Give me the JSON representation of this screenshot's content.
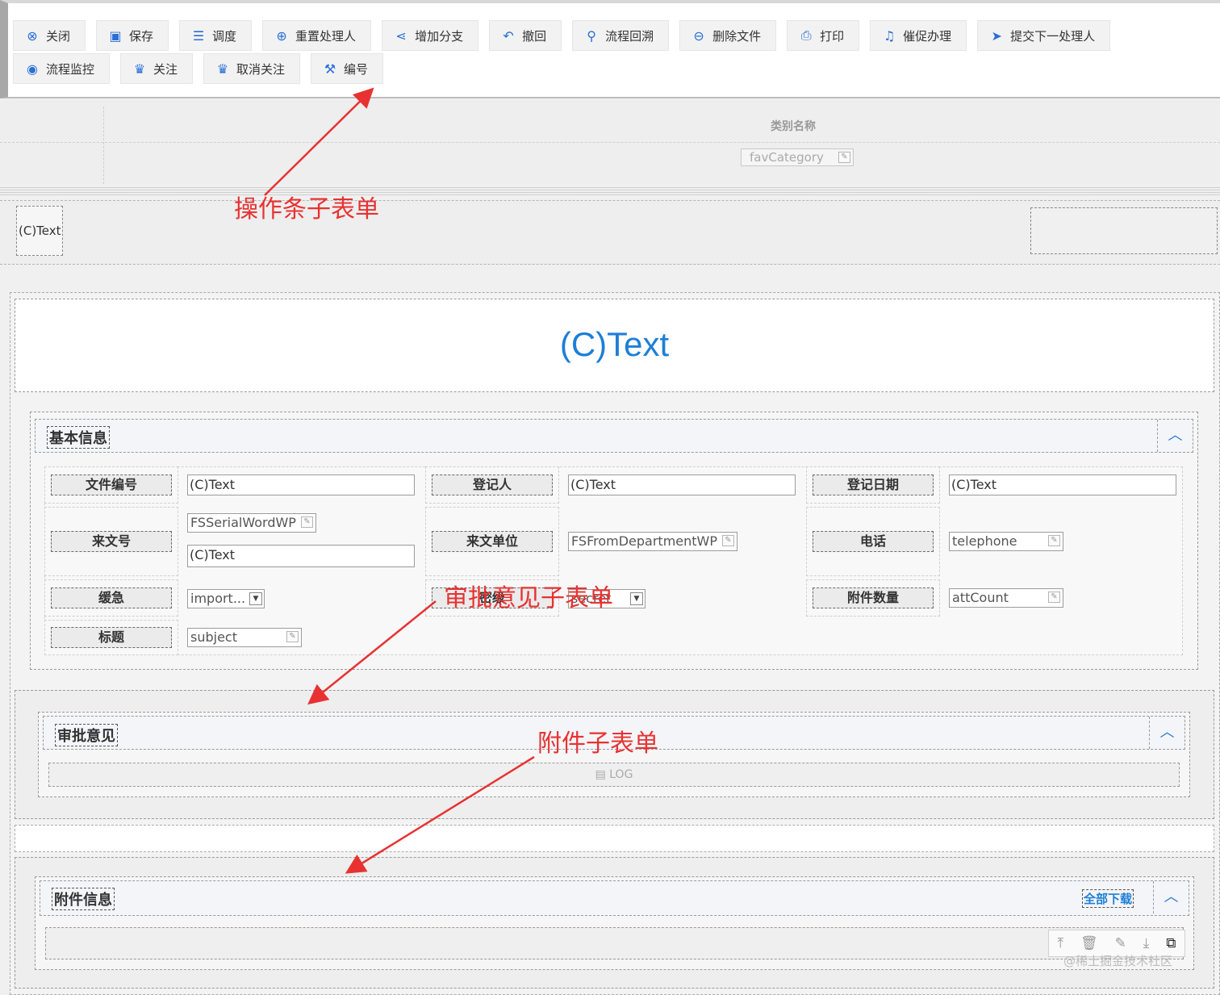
{
  "toolbar": {
    "row1": [
      {
        "label": "关闭",
        "icon": "close-circle-icon",
        "glyph": "⊗"
      },
      {
        "label": "保存",
        "icon": "save-icon",
        "glyph": "▣"
      },
      {
        "label": "调度",
        "icon": "schedule-icon",
        "glyph": "☰"
      },
      {
        "label": "重置处理人",
        "icon": "reset-handler-icon",
        "glyph": "⊕"
      },
      {
        "label": "增加分支",
        "icon": "branch-icon",
        "glyph": "⋖"
      },
      {
        "label": "撤回",
        "icon": "undo-icon",
        "glyph": "↶"
      },
      {
        "label": "流程回溯",
        "icon": "trace-icon",
        "glyph": "⚲"
      },
      {
        "label": "删除文件",
        "icon": "delete-file-icon",
        "glyph": "⊖"
      },
      {
        "label": "打印",
        "icon": "print-icon",
        "glyph": "⎙"
      },
      {
        "label": "催促办理",
        "icon": "bell-icon",
        "glyph": "♫"
      },
      {
        "label": "提交下一处理人",
        "icon": "send-icon",
        "glyph": "➤"
      }
    ],
    "row2": [
      {
        "label": "流程监控",
        "icon": "monitor-icon",
        "glyph": "◉"
      },
      {
        "label": "关注",
        "icon": "trophy-icon",
        "glyph": "♛"
      },
      {
        "label": "取消关注",
        "icon": "trophy-icon",
        "glyph": "♛"
      },
      {
        "label": "编号",
        "icon": "wrench-icon",
        "glyph": "⚒"
      }
    ]
  },
  "category": {
    "label": "类别名称",
    "input": "favCategory"
  },
  "strip": {
    "text": "(C)Text"
  },
  "form_title": "(C)Text",
  "basic": {
    "title": "基本信息",
    "fields": {
      "doc_no_label": "文件编号",
      "doc_no_val": "(C)Text",
      "registrar_label": "登记人",
      "registrar_val": "(C)Text",
      "reg_date_label": "登记日期",
      "reg_date_val": "(C)Text",
      "incoming_no_label": "来文号",
      "incoming_no_input": "FSSerialWordWP",
      "incoming_no_val": "(C)Text",
      "incoming_unit_label": "来文单位",
      "incoming_unit_input": "FSFromDepartmentWP",
      "phone_label": "电话",
      "phone_input": "telephone",
      "urgency_label": "缓急",
      "urgency_select": "import...",
      "secret_label": "密级",
      "secret_select": "secret",
      "att_count_label": "附件数量",
      "att_count_input": "attCount",
      "subject_label": "标题",
      "subject_input": "subject"
    }
  },
  "approval": {
    "title": "审批意见",
    "log": "LOG"
  },
  "attachment": {
    "title": "附件信息",
    "download_all": "全部下载"
  },
  "annotations": {
    "toolbar_sub": "操作条子表单",
    "approval_sub": "审批意见子表单",
    "attachment_sub": "附件子表单"
  },
  "watermark": "@稀土掘金技术社区"
}
